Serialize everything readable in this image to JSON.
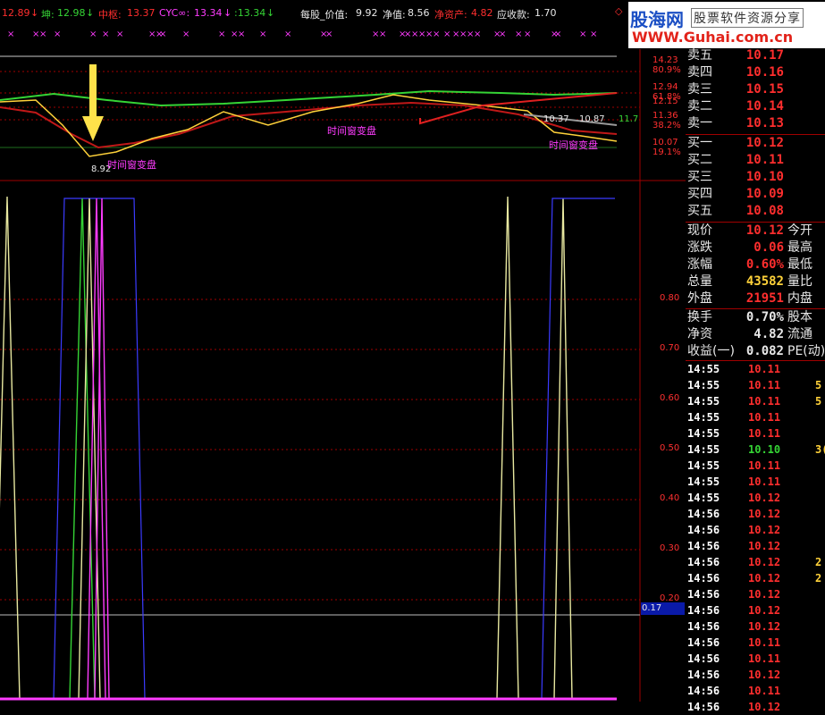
{
  "topbar": {
    "v1": "12.89",
    "kun_label": "坤:",
    "kun_value": "12.98",
    "zhongshu_label": "中枢:",
    "zhongshu_value": "13.37",
    "cyc_label": "CYC∞:",
    "cyc_value": "13.34",
    "cyc2_value": ":13.34",
    "per_share_label": "每股_价值:",
    "per_share_value": "9.92",
    "net_label": "净值:",
    "net_value": "8.56",
    "net_assets_label": "净资产:",
    "net_assets_value": "4.82",
    "receivable_label": "应收款:",
    "receivable_value": "1.70",
    "arrow_down": "↓"
  },
  "logo": {
    "brand": "股海网",
    "tagline": "股票软件资源分享",
    "url": "WWW.Guhai.com.cn"
  },
  "price_chart": {
    "annotations": [
      "时间窗变盘",
      "时间窗变盘",
      "时间窗变盘"
    ],
    "low_label": "8.92",
    "point_labels": [
      "10.37",
      "10.87",
      "11.7"
    ],
    "right_axis": [
      {
        "value": "14.23",
        "pct": "80.9%"
      },
      {
        "value": "12.94",
        "pct": "61.8%"
      },
      {
        "value": "12.15",
        "pct": ""
      },
      {
        "value": "11.36",
        "pct": "38.2%"
      },
      {
        "value": "10.07",
        "pct": "19.1%"
      }
    ]
  },
  "indicator_chart": {
    "right_axis": [
      "0.80",
      "0.70",
      "0.60",
      "0.50",
      "0.40",
      "0.30",
      "0.20"
    ],
    "cursor_value": "0.17"
  },
  "quote_panel": {
    "asks": [
      {
        "label": "卖五",
        "price": "10.17"
      },
      {
        "label": "卖四",
        "price": "10.16"
      },
      {
        "label": "卖三",
        "price": "10.15"
      },
      {
        "label": "卖二",
        "price": "10.14"
      },
      {
        "label": "卖一",
        "price": "10.13"
      }
    ],
    "bids": [
      {
        "label": "买一",
        "price": "10.12"
      },
      {
        "label": "买二",
        "price": "10.11"
      },
      {
        "label": "买三",
        "price": "10.10"
      },
      {
        "label": "买四",
        "price": "10.09"
      },
      {
        "label": "买五",
        "price": "10.08"
      }
    ],
    "stats": [
      {
        "label": "现价",
        "value": "10.12",
        "right": "今开",
        "color": "#ff2e2e"
      },
      {
        "label": "涨跌",
        "value": "0.06",
        "right": "最高",
        "color": "#ff2e2e"
      },
      {
        "label": "涨幅",
        "value": "0.60%",
        "right": "最低",
        "color": "#ff2e2e"
      },
      {
        "label": "总量",
        "value": "43582",
        "right": "量比",
        "color": "#ffd23a"
      },
      {
        "label": "外盘",
        "value": "21951",
        "right": "内盘",
        "color": "#ff2e2e"
      },
      {
        "label": "换手",
        "value": "0.70%",
        "right": "股本",
        "color": "#e8e8e8"
      },
      {
        "label": "净资",
        "value": "4.82",
        "right": "流通",
        "color": "#e8e8e8"
      },
      {
        "label": "收益(一)",
        "value": "0.082",
        "right": "PE(动)",
        "color": "#e8e8e8"
      }
    ],
    "ticks": [
      {
        "time": "14:55",
        "price": "10.11",
        "vol": ""
      },
      {
        "time": "14:55",
        "price": "10.11",
        "vol": "5"
      },
      {
        "time": "14:55",
        "price": "10.11",
        "vol": "5"
      },
      {
        "time": "14:55",
        "price": "10.11",
        "vol": ""
      },
      {
        "time": "14:55",
        "price": "10.11",
        "vol": ""
      },
      {
        "time": "14:55",
        "price": "10.10",
        "vol": "3("
      },
      {
        "time": "14:55",
        "price": "10.11",
        "vol": ""
      },
      {
        "time": "14:55",
        "price": "10.11",
        "vol": ""
      },
      {
        "time": "14:55",
        "price": "10.12",
        "vol": ""
      },
      {
        "time": "14:56",
        "price": "10.12",
        "vol": ""
      },
      {
        "time": "14:56",
        "price": "10.12",
        "vol": ""
      },
      {
        "time": "14:56",
        "price": "10.12",
        "vol": ""
      },
      {
        "time": "14:56",
        "price": "10.12",
        "vol": "2"
      },
      {
        "time": "14:56",
        "price": "10.12",
        "vol": "2"
      },
      {
        "time": "14:56",
        "price": "10.12",
        "vol": ""
      },
      {
        "time": "14:56",
        "price": "10.12",
        "vol": ""
      },
      {
        "time": "14:56",
        "price": "10.12",
        "vol": ""
      },
      {
        "time": "14:56",
        "price": "10.11",
        "vol": ""
      },
      {
        "time": "14:56",
        "price": "10.11",
        "vol": ""
      },
      {
        "time": "14:56",
        "price": "10.12",
        "vol": ""
      },
      {
        "time": "14:56",
        "price": "10.11",
        "vol": ""
      },
      {
        "time": "14:56",
        "price": "10.12",
        "vol": ""
      }
    ]
  },
  "colors": {
    "red": "#ff2e2e",
    "yellow": "#ffd23a",
    "green": "#35d435",
    "magenta": "#ff3cff",
    "blue": "#3b3bff",
    "grid": "#a00000"
  }
}
